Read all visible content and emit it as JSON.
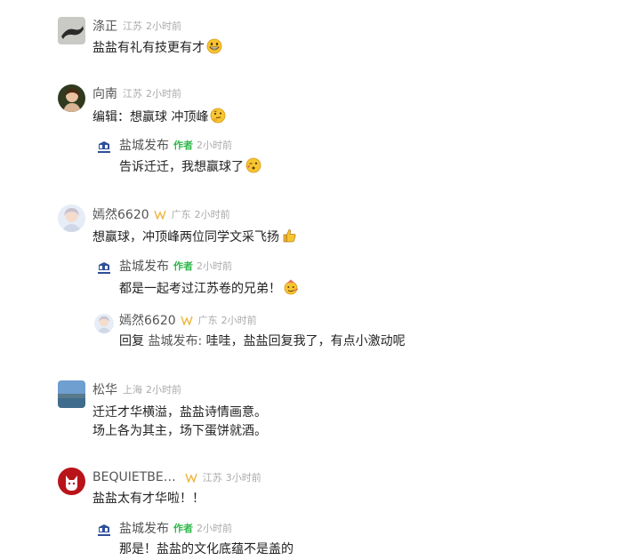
{
  "comments": [
    {
      "name": "涤正",
      "location": "江苏",
      "time": "2小时前",
      "text": "盐盐有礼有技更有才",
      "emoji": "grinning-face"
    },
    {
      "name": "向南",
      "location": "江苏",
      "time": "2小时前",
      "text": "编辑：想赢球 冲顶峰",
      "emoji": "thinking-face",
      "replies": [
        {
          "name": "盐城发布",
          "author_badge": "作者",
          "time": "2小时前",
          "text": "告诉迁迁，我想赢球了",
          "emoji": "winking-kiss-face"
        }
      ]
    },
    {
      "name": "嫣然6620",
      "location": "广东",
      "time": "2小时前",
      "text": "想赢球，冲顶峰两位同学文采飞扬",
      "emoji": "thumbs-up",
      "replies": [
        {
          "name": "盐城发布",
          "author_badge": "作者",
          "time": "2小时前",
          "text": "都是一起考过江苏卷的兄弟！",
          "emoji": "party-face"
        },
        {
          "name": "嫣然6620",
          "location": "广东",
          "time": "2小时前",
          "reply_prefix": "回复 ",
          "reply_to": "盐城发布:",
          "text": " 哇哇，盐盐回复我了，有点小激动呢"
        }
      ]
    },
    {
      "name": "松华",
      "location": "上海",
      "time": "2小时前",
      "text_lines": [
        "迁迁才华横溢，盐盐诗情画意。",
        "场上各为其主，场下蛋饼就酒。"
      ]
    },
    {
      "name": "BEQUIETBE…",
      "location": "江苏",
      "time": "3小时前",
      "text": "盐盐太有才华啦！！",
      "replies": [
        {
          "name": "盐城发布",
          "author_badge": "作者",
          "time": "2小时前",
          "text": "那是！盐盐的文化底蕴不是盖的"
        }
      ]
    }
  ],
  "colors": {
    "author_badge": "#2eb84a",
    "vip_badge": "#f0b43c",
    "meta": "#aaaaaa"
  }
}
